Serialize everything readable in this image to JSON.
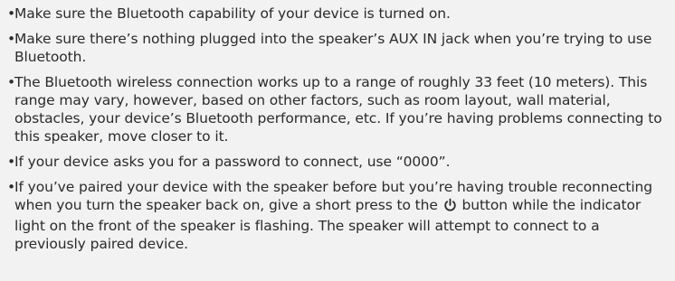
{
  "bullets": [
    {
      "mark": "•",
      "text": "Make sure the Bluetooth capability of your device is turned on."
    },
    {
      "mark": "•",
      "text": "Make sure there’s nothing plugged into the speaker’s AUX IN jack when you’re trying to use Bluetooth."
    },
    {
      "mark": "•",
      "text": " The Bluetooth wireless connection works up to a range of roughly 33 feet (10 meters). This range may vary, however, based on other factors, such as room layout, wall material, obstacles, your device’s Bluetooth performance, etc. If you’re having problems connecting to this speaker, move closer to it."
    },
    {
      "mark": "•",
      "text": "If your device asks you for a password to connect, use “0000”."
    },
    {
      "mark": "•",
      "text_before_icon": "If you’ve paired your device with the speaker before but you’re having trouble reconnecting when you turn the speaker back on, give a short press to the",
      "icon": "power-icon",
      "text_after_icon": "button while the indicator light on the front of the speaker is flashing. The speaker will attempt to connect to a previously paired device."
    }
  ]
}
